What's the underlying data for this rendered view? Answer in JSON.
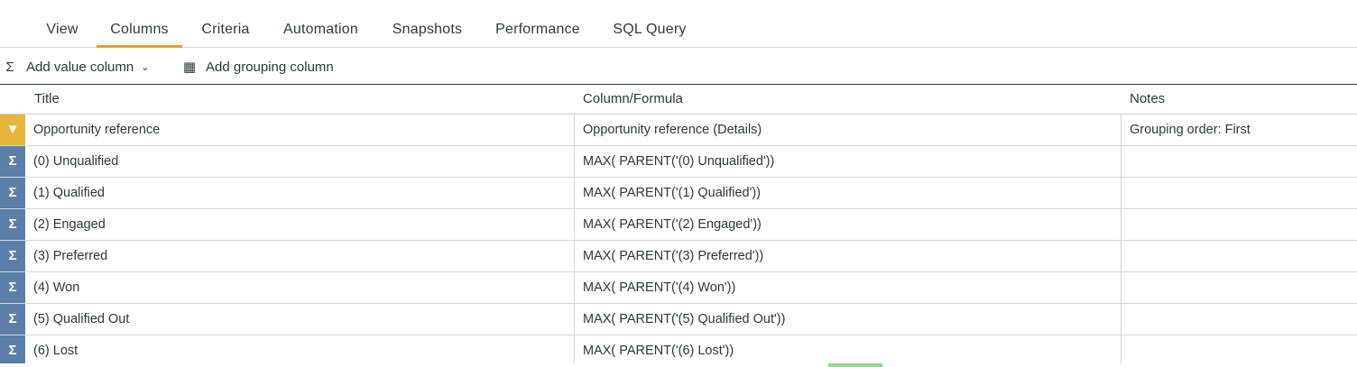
{
  "tabs": [
    {
      "label": "View",
      "active": false
    },
    {
      "label": "Columns",
      "active": true
    },
    {
      "label": "Criteria",
      "active": false
    },
    {
      "label": "Automation",
      "active": false
    },
    {
      "label": "Snapshots",
      "active": false
    },
    {
      "label": "Performance",
      "active": false
    },
    {
      "label": "SQL Query",
      "active": false
    }
  ],
  "toolbar": {
    "add_value_column": "Add value column",
    "add_grouping_column": "Add grouping column",
    "sigma_glyph": "Σ",
    "chevron_glyph": "⌄",
    "grid_glyph": "▦"
  },
  "table": {
    "headers": [
      "Title",
      "Column/Formula",
      "Notes"
    ],
    "rows": [
      {
        "marker": "filter",
        "marker_glyph": "▼",
        "title": "Opportunity reference",
        "formula": "Opportunity reference (Details)",
        "notes": "Grouping order: First"
      },
      {
        "marker": "sigma",
        "marker_glyph": "Σ",
        "title": "(0) Unqualified",
        "formula": "MAX( PARENT('(0) Unqualified'))",
        "notes": ""
      },
      {
        "marker": "sigma",
        "marker_glyph": "Σ",
        "title": "(1) Qualified",
        "formula": "MAX( PARENT('(1) Qualified'))",
        "notes": ""
      },
      {
        "marker": "sigma",
        "marker_glyph": "Σ",
        "title": "(2) Engaged",
        "formula": "MAX( PARENT('(2) Engaged'))",
        "notes": ""
      },
      {
        "marker": "sigma",
        "marker_glyph": "Σ",
        "title": "(3) Preferred",
        "formula": "MAX( PARENT('(3) Preferred'))",
        "notes": ""
      },
      {
        "marker": "sigma",
        "marker_glyph": "Σ",
        "title": "(4) Won",
        "formula": "MAX( PARENT('(4) Won'))",
        "notes": ""
      },
      {
        "marker": "sigma",
        "marker_glyph": "Σ",
        "title": "(5) Qualified Out",
        "formula": "MAX( PARENT('(5) Qualified Out'))",
        "notes": ""
      },
      {
        "marker": "sigma",
        "marker_glyph": "Σ",
        "title": "(6) Lost",
        "formula": "MAX( PARENT('(6) Lost'))",
        "notes": ""
      }
    ]
  },
  "colors": {
    "active_tab_underline": "#e89a3c",
    "sigma_marker": "#5b7fa8",
    "filter_marker": "#e8b43a"
  }
}
